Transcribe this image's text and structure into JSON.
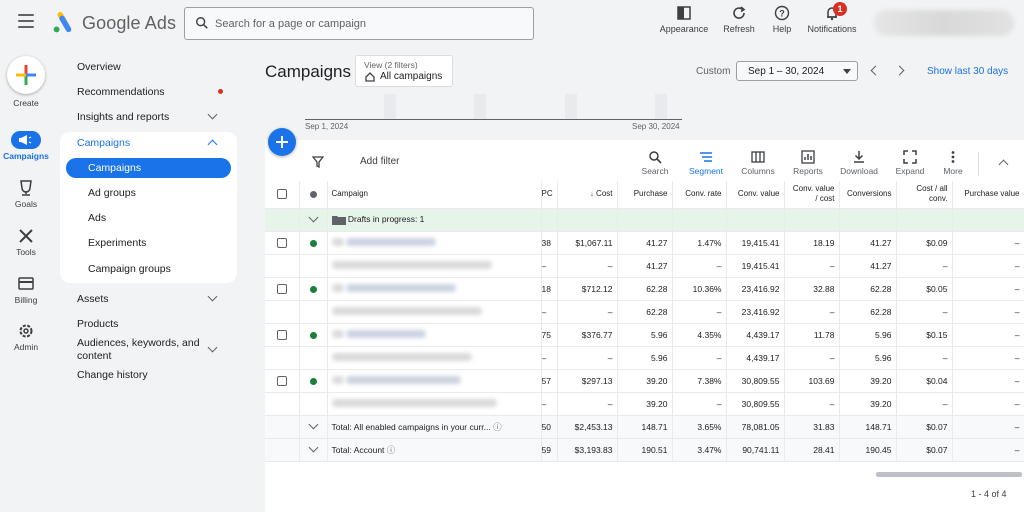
{
  "app": {
    "brand": "Google Ads"
  },
  "search": {
    "placeholder": "Search for a page or campaign"
  },
  "top_actions": [
    {
      "label": "Appearance",
      "icon": "appearance-icon"
    },
    {
      "label": "Refresh",
      "icon": "refresh-icon"
    },
    {
      "label": "Help",
      "icon": "help-icon"
    },
    {
      "label": "Notifications",
      "icon": "bell-icon",
      "badge": "1"
    }
  ],
  "rail": {
    "create": "Create",
    "items": [
      {
        "label": "Campaigns",
        "icon": "megaphone-icon",
        "active": true
      },
      {
        "label": "Goals",
        "icon": "trophy-icon"
      },
      {
        "label": "Tools",
        "icon": "tools-icon"
      },
      {
        "label": "Billing",
        "icon": "credit-card-icon"
      },
      {
        "label": "Admin",
        "icon": "gear-icon"
      }
    ]
  },
  "nav": {
    "overview": "Overview",
    "recommendations": "Recommendations",
    "insights": "Insights and reports",
    "campaigns_group": "Campaigns",
    "sub": [
      "Campaigns",
      "Ad groups",
      "Ads",
      "Experiments",
      "Campaign groups"
    ],
    "assets": "Assets",
    "products": "Products",
    "audiences": "Audiences, keywords, and content",
    "history": "Change history"
  },
  "header": {
    "title": "Campaigns",
    "view_filter_top": "View (2 filters)",
    "view_filter_bottom": "All campaigns",
    "custom": "Custom",
    "date_range": "Sep 1 – 30, 2024",
    "show_last": "Show last 30 days"
  },
  "timeline": {
    "start": "Sep 1, 2024",
    "end": "Sep 30, 2024"
  },
  "toolbar": {
    "add_filter": "Add filter",
    "buttons": [
      {
        "label": "Search",
        "icon": "search-icon"
      },
      {
        "label": "Segment",
        "icon": "segment-icon",
        "active": true
      },
      {
        "label": "Columns",
        "icon": "columns-icon"
      },
      {
        "label": "Reports",
        "icon": "reports-icon"
      },
      {
        "label": "Download",
        "icon": "download-icon"
      },
      {
        "label": "Expand",
        "icon": "expand-icon"
      },
      {
        "label": "More",
        "icon": "more-icon"
      }
    ]
  },
  "table": {
    "columns": [
      "Campaign",
      "PC",
      "Cost",
      "Purchase",
      "Conv. rate",
      "Conv. value",
      "Conv. value / cost",
      "Conversions",
      "Cost / all conv.",
      "Purchase value"
    ],
    "drafts": "Drafts in progress: 1",
    "rows": [
      {
        "pc": "38",
        "cost": "$1,067.11",
        "purchase": "41.27",
        "rate": "1.47%",
        "value": "19,415.41",
        "vcost": "18.19",
        "conv": "41.27",
        "cpa": "$0.09",
        "pval": "–",
        "sub": {
          "pc": "–",
          "cost": "–",
          "purchase": "41.27",
          "rate": "–",
          "value": "19,415.41",
          "vcost": "–",
          "conv": "41.27",
          "cpa": "–",
          "pval": "–"
        }
      },
      {
        "pc": "18",
        "cost": "$712.12",
        "purchase": "62.28",
        "rate": "10.36%",
        "value": "23,416.92",
        "vcost": "32.88",
        "conv": "62.28",
        "cpa": "$0.05",
        "pval": "–",
        "sub": {
          "pc": "–",
          "cost": "–",
          "purchase": "62.28",
          "rate": "–",
          "value": "23,416.92",
          "vcost": "–",
          "conv": "62.28",
          "cpa": "–",
          "pval": "–"
        }
      },
      {
        "pc": "75",
        "cost": "$376.77",
        "purchase": "5.96",
        "rate": "4.35%",
        "value": "4,439.17",
        "vcost": "11.78",
        "conv": "5.96",
        "cpa": "$0.15",
        "pval": "–",
        "sub": {
          "pc": "–",
          "cost": "–",
          "purchase": "5.96",
          "rate": "–",
          "value": "4,439.17",
          "vcost": "–",
          "conv": "5.96",
          "cpa": "–",
          "pval": "–"
        }
      },
      {
        "pc": "57",
        "cost": "$297.13",
        "purchase": "39.20",
        "rate": "7.38%",
        "value": "30,809.55",
        "vcost": "103.69",
        "conv": "39.20",
        "cpa": "$0.04",
        "pval": "–",
        "sub": {
          "pc": "–",
          "cost": "–",
          "purchase": "39.20",
          "rate": "–",
          "value": "30,809.55",
          "vcost": "–",
          "conv": "39.20",
          "cpa": "–",
          "pval": "–"
        }
      }
    ],
    "totals": [
      {
        "label": "Total: All enabled campaigns in your curr...",
        "pc": "50",
        "cost": "$2,453.13",
        "purchase": "148.71",
        "rate": "3.65%",
        "value": "78,081.05",
        "vcost": "31.83",
        "conv": "148.71",
        "cpa": "$0.07",
        "pval": "–"
      },
      {
        "label": "Total: Account",
        "pc": "59",
        "cost": "$3,193.83",
        "purchase": "190.51",
        "rate": "3.47%",
        "value": "90,741.11",
        "vcost": "28.41",
        "conv": "190.45",
        "cpa": "$0.07",
        "pval": "–"
      }
    ]
  },
  "pagination": "1 - 4 of 4",
  "colors": {
    "accent": "#1a73e8",
    "enabled": "#188038",
    "badge": "#d93025"
  }
}
